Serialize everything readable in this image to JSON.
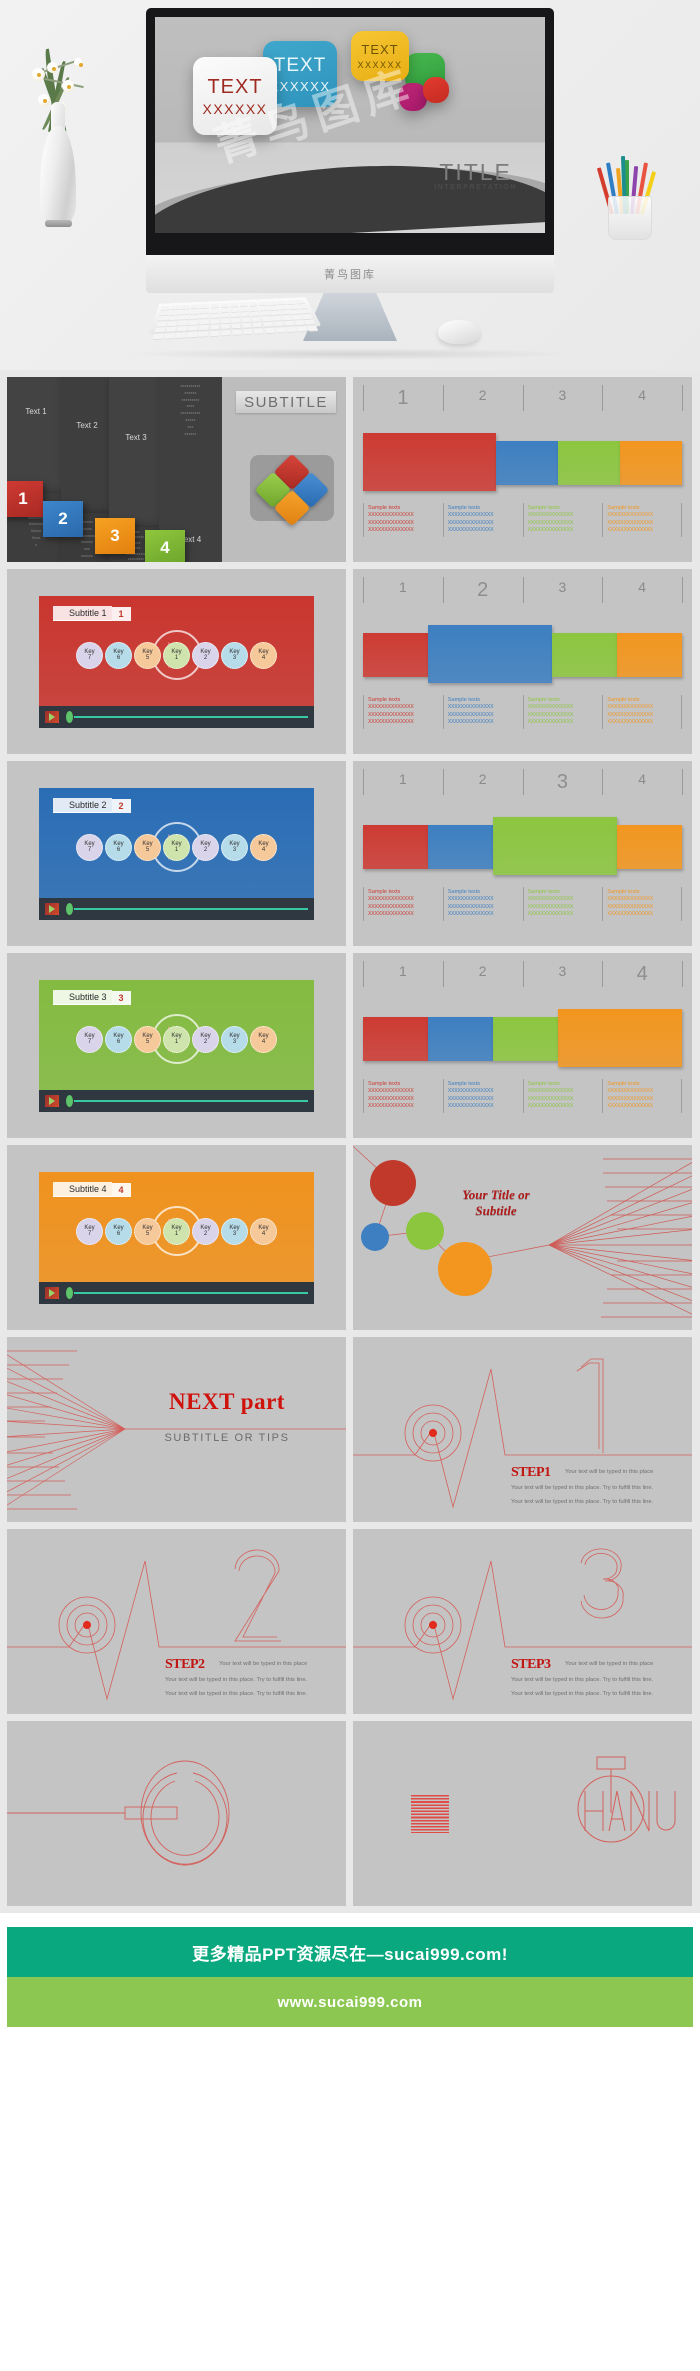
{
  "hero": {
    "tiles": [
      {
        "name": "tile-white",
        "line1": "TEXT",
        "line2": "XXXXXX"
      },
      {
        "name": "tile-blue",
        "line1": "TEXT",
        "line2": "XXXXXX"
      },
      {
        "name": "tile-yellow",
        "line1": "TEXT",
        "line2": "XXXXXX"
      }
    ],
    "screen_title": "TITLE",
    "screen_subtitle": "INTERPRETATION",
    "brand": "菁鸟图库"
  },
  "slide_overview": {
    "panels": [
      {
        "label": "Text 1",
        "body": "Xxxxx\nXxxxxxx\nXxxxxxxx\nXxxxxxx\nXxxxx\nXxxx\nx"
      },
      {
        "label": "Text 2",
        "body": "xxxxxx\nxxxxx\nxxxxxxxxx\nxxxxxx\nxxx\nxxxxxx\nxxxxx"
      },
      {
        "label": "Text 3",
        "body": "xxxx\nxxxxxxxxx\nxxxxx\nxxxxx\nxxxxxxxxxxx\nxxxxxxxxx\nxxxx"
      },
      {
        "label": "Text 4",
        "body": "xxxxxxxxxx\nxxxxxx\nxxxxxxxxx\nxxxx\nxxxxxxxxxx\nxxxxx\nxxx\nxxxxxx"
      }
    ],
    "numbers": [
      "1",
      "2",
      "3",
      "4"
    ],
    "subtitle": "SUBTITLE"
  },
  "key_slides": [
    {
      "label": "Subtitle 1",
      "num": "1",
      "accent": "#c9362f"
    },
    {
      "label": "Subtitle 2",
      "num": "2",
      "accent": "#2a6db5"
    },
    {
      "label": "Subtitle 3",
      "num": "3",
      "accent": "#84bb41"
    },
    {
      "label": "Subtitle 4",
      "num": "4",
      "accent": "#f0921e"
    }
  ],
  "key_items": [
    {
      "t": "Key",
      "n": "7"
    },
    {
      "t": "Key",
      "n": "6"
    },
    {
      "t": "Key",
      "n": "5"
    },
    {
      "t": "Key",
      "n": "1"
    },
    {
      "t": "Key",
      "n": "2"
    },
    {
      "t": "Key",
      "n": "3"
    },
    {
      "t": "Key",
      "n": "4"
    }
  ],
  "chart_data": [
    {
      "type": "bar",
      "orientation": "horizontal-stacked",
      "title": "",
      "categories": [
        "1",
        "2",
        "3",
        "4"
      ],
      "values": [
        2.15,
        1.0,
        1.0,
        1.0
      ],
      "highlight": "1",
      "colors": [
        "#cc3b33",
        "#3d7fc1",
        "#8cc63f",
        "#f2961f"
      ],
      "sample_label": "Sample texts",
      "sample_body": "XXXXXXXXXXXXXX",
      "xlabel": "",
      "ylabel": "",
      "grid": false,
      "legend": "none"
    },
    {
      "type": "bar",
      "orientation": "horizontal-stacked",
      "title": "",
      "categories": [
        "1",
        "2",
        "3",
        "4"
      ],
      "values": [
        1.0,
        1.9,
        1.0,
        1.0
      ],
      "highlight": "2",
      "colors": [
        "#cc3b33",
        "#3d7fc1",
        "#8cc63f",
        "#f2961f"
      ],
      "sample_label": "Sample texts",
      "sample_body": "XXXXXXXXXXXXXX",
      "xlabel": "",
      "ylabel": "",
      "grid": false,
      "legend": "none"
    },
    {
      "type": "bar",
      "orientation": "horizontal-stacked",
      "title": "",
      "categories": [
        "1",
        "2",
        "3",
        "4"
      ],
      "values": [
        1.0,
        1.0,
        1.9,
        1.0
      ],
      "highlight": "3",
      "colors": [
        "#cc3b33",
        "#3d7fc1",
        "#8cc63f",
        "#f2961f"
      ],
      "sample_label": "Sample texts",
      "sample_body": "XXXXXXXXXXXXXX",
      "xlabel": "",
      "ylabel": "",
      "grid": false,
      "legend": "none"
    },
    {
      "type": "bar",
      "orientation": "horizontal-stacked",
      "title": "",
      "categories": [
        "1",
        "2",
        "3",
        "4"
      ],
      "values": [
        1.0,
        1.0,
        1.0,
        1.9
      ],
      "highlight": "4",
      "colors": [
        "#cc3b33",
        "#3d7fc1",
        "#8cc63f",
        "#f2961f"
      ],
      "sample_label": "Sample texts",
      "sample_body": "XXXXXXXXXXXXXX",
      "xlabel": "",
      "ylabel": "",
      "grid": false,
      "legend": "none"
    }
  ],
  "network_slide": {
    "title_line1": "Your Title or",
    "title_line2": "Subtitle",
    "node_colors": [
      "#c0392b",
      "#3d7fc1",
      "#8cc63f",
      "#f2961f"
    ]
  },
  "next_slide": {
    "title": "NEXT part",
    "subtitle": "SUBTITLE OR TIPS"
  },
  "step_slides": [
    {
      "label": "STEP1",
      "numeral": "1",
      "line1": "Your text will be typed in this place",
      "line2": "Your text will be typed in this place. Try to fulfill this line.",
      "line3": "Your text will be typed in this place. Try to fulfill this line."
    },
    {
      "label": "STEP2",
      "numeral": "2",
      "line1": "Your text will be typed in this place",
      "line2": "Your text will be typed in this place. Try to fulfill this line.",
      "line3": "Your text will be typed in this place. Try to fulfill this line."
    },
    {
      "label": "STEP3",
      "numeral": "3",
      "line1": "Your text will be typed in this place",
      "line2": "Your text will be typed in this place. Try to fulfill this line.",
      "line3": "Your text will be typed in this place. Try to fulfill this line."
    }
  ],
  "logo_slide": {
    "wordmark": "HANKU"
  },
  "footer": {
    "top_text": "更多精品PPT资源尽在—sucai999.com!",
    "bottom_text": "www.sucai999.com",
    "top_color": "#0aa87e",
    "bottom_color": "#8cc751"
  },
  "watermark": "菁鸟图库"
}
